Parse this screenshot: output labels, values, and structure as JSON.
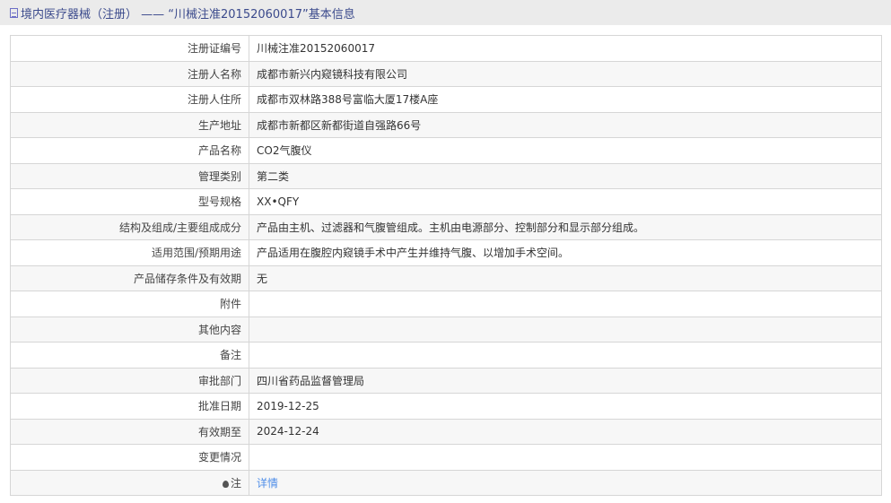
{
  "header": {
    "title": "境内医疗器械（注册） —— “川械注准20152060017”基本信息"
  },
  "rows": [
    {
      "label": "注册证编号",
      "value": "川械注准20152060017"
    },
    {
      "label": "注册人名称",
      "value": "成都市新兴内窥镜科技有限公司"
    },
    {
      "label": "注册人住所",
      "value": "成都市双林路388号富临大厦17楼A座"
    },
    {
      "label": "生产地址",
      "value": "成都市新都区新都街道自强路66号"
    },
    {
      "label": "产品名称",
      "value": "CO2气腹仪"
    },
    {
      "label": "管理类别",
      "value": "第二类"
    },
    {
      "label": "型号规格",
      "value": "XX•QFY"
    },
    {
      "label": "结构及组成/主要组成成分",
      "value": "产品由主机、过滤器和气腹管组成。主机由电源部分、控制部分和显示部分组成。"
    },
    {
      "label": "适用范围/预期用途",
      "value": "产品适用在腹腔内窥镜手术中产生并维持气腹、以增加手术空间。"
    },
    {
      "label": "产品储存条件及有效期",
      "value": "无"
    },
    {
      "label": "附件",
      "value": ""
    },
    {
      "label": "其他内容",
      "value": ""
    },
    {
      "label": "备注",
      "value": ""
    },
    {
      "label": "审批部门",
      "value": "四川省药品监督管理局"
    },
    {
      "label": "批准日期",
      "value": "2019-12-25"
    },
    {
      "label": "有效期至",
      "value": "2024-12-24"
    },
    {
      "label": "变更情况",
      "value": ""
    }
  ],
  "note": {
    "label": "注",
    "link": "详情"
  }
}
